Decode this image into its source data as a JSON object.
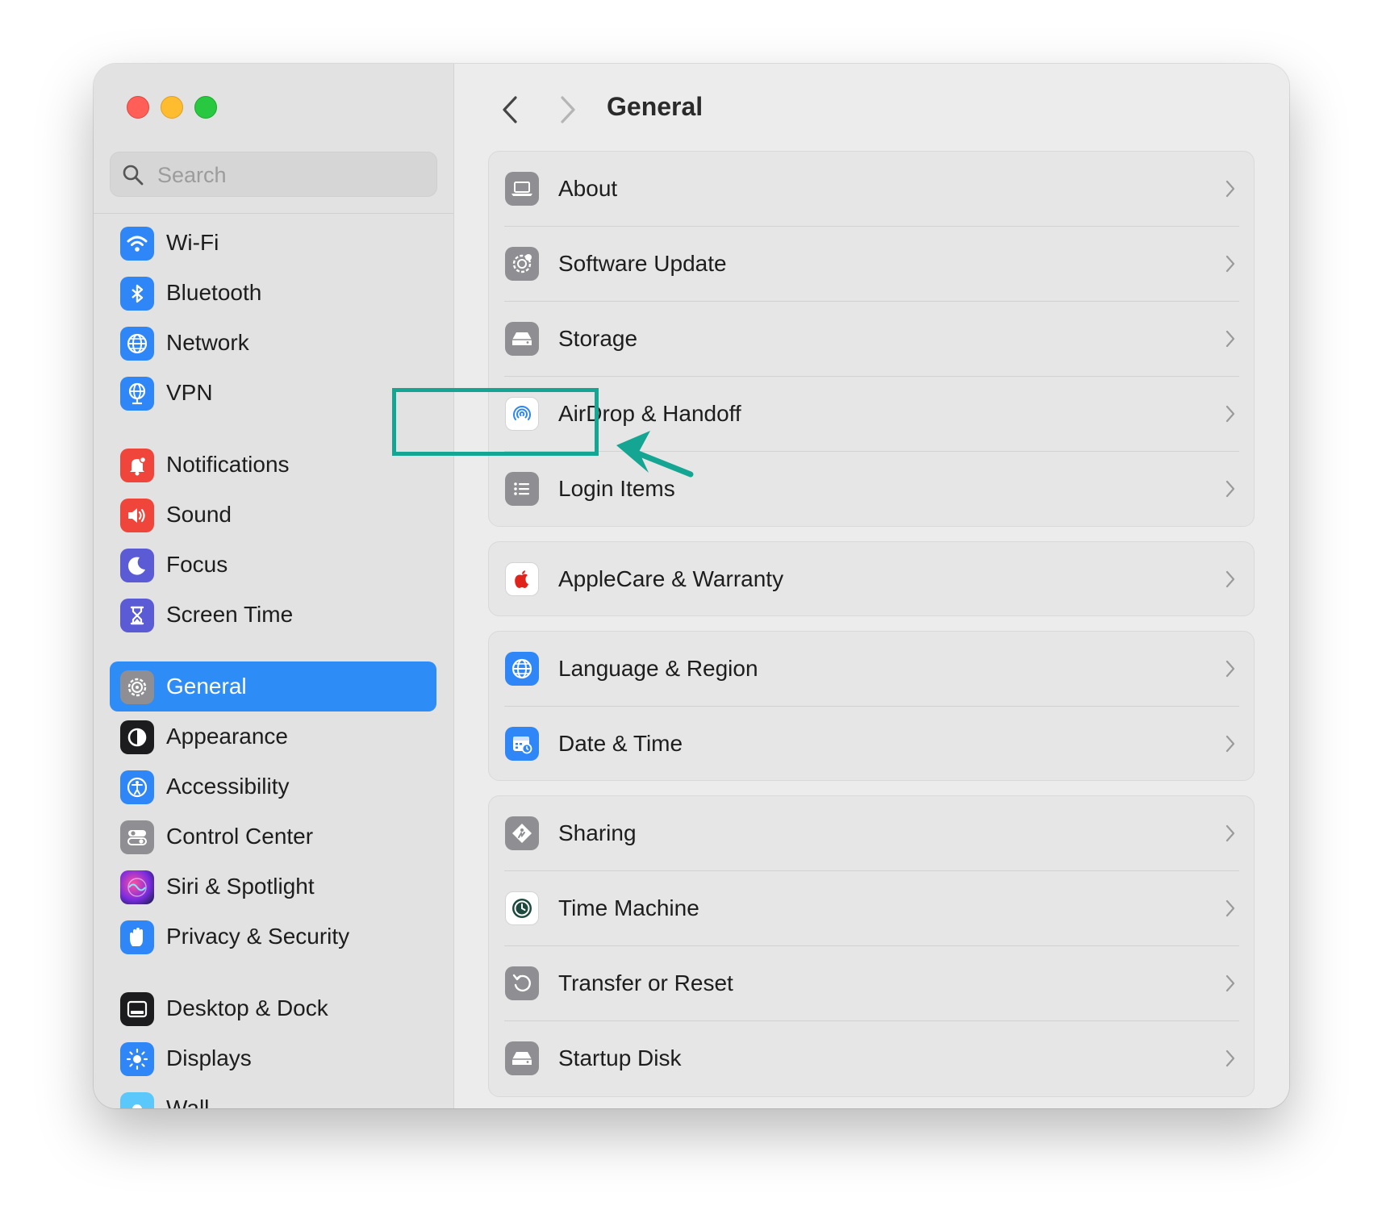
{
  "window": {
    "traffic_lights": [
      "close",
      "minimize",
      "zoom"
    ]
  },
  "sidebar": {
    "search_placeholder": "Search",
    "items": [
      {
        "label": "Wi-Fi",
        "icon": "wifi-icon",
        "color": "#2f86f6"
      },
      {
        "label": "Bluetooth",
        "icon": "bluetooth-icon",
        "color": "#2f86f6"
      },
      {
        "label": "Network",
        "icon": "globe-icon",
        "color": "#2f86f6"
      },
      {
        "label": "VPN",
        "icon": "vpn-globe-icon",
        "color": "#2f86f6"
      },
      {
        "label": "Notifications",
        "icon": "bell-icon",
        "color": "#f0453a"
      },
      {
        "label": "Sound",
        "icon": "speaker-icon",
        "color": "#f0453a"
      },
      {
        "label": "Focus",
        "icon": "moon-icon",
        "color": "#5b5bd6"
      },
      {
        "label": "Screen Time",
        "icon": "hourglass-icon",
        "color": "#5b5bd6"
      },
      {
        "label": "General",
        "icon": "gear-icon",
        "color": "#8e8e93",
        "selected": true
      },
      {
        "label": "Appearance",
        "icon": "appearance-icon",
        "color": "#1c1c1e"
      },
      {
        "label": "Accessibility",
        "icon": "accessibility-icon",
        "color": "#2f86f6"
      },
      {
        "label": "Control Center",
        "icon": "toggles-icon",
        "color": "#8e8e93"
      },
      {
        "label": "Siri & Spotlight",
        "icon": "siri-icon",
        "color": "#a23cd6"
      },
      {
        "label": "Privacy & Security",
        "icon": "hand-icon",
        "color": "#2f86f6"
      },
      {
        "label": "Desktop & Dock",
        "icon": "dock-icon",
        "color": "#1c1c1e"
      },
      {
        "label": "Displays",
        "icon": "sun-icon",
        "color": "#2f86f6"
      },
      {
        "label": "Wall",
        "icon": "wallpaper-icon",
        "color": "#5ac8fa"
      }
    ],
    "accent": "#2e8cf6"
  },
  "main": {
    "title": "General",
    "groups": [
      {
        "rows": [
          {
            "label": "About",
            "icon": "laptop-icon"
          },
          {
            "label": "Software Update",
            "icon": "gear-badge-icon"
          },
          {
            "label": "Storage",
            "icon": "drive-icon"
          },
          {
            "label": "AirDrop & Handoff",
            "icon": "airdrop-icon"
          },
          {
            "label": "Login Items",
            "icon": "list-icon"
          }
        ]
      },
      {
        "rows": [
          {
            "label": "AppleCare & Warranty",
            "icon": "apple-icon"
          }
        ]
      },
      {
        "rows": [
          {
            "label": "Language & Region",
            "icon": "globe-icon"
          },
          {
            "label": "Date & Time",
            "icon": "calendar-clock-icon"
          }
        ]
      },
      {
        "rows": [
          {
            "label": "Sharing",
            "icon": "sharing-icon"
          },
          {
            "label": "Time Machine",
            "icon": "time-machine-icon"
          },
          {
            "label": "Transfer or Reset",
            "icon": "reset-icon"
          },
          {
            "label": "Startup Disk",
            "icon": "drive-icon"
          }
        ]
      }
    ]
  },
  "annotation": {
    "highlight_color": "#14a693"
  }
}
